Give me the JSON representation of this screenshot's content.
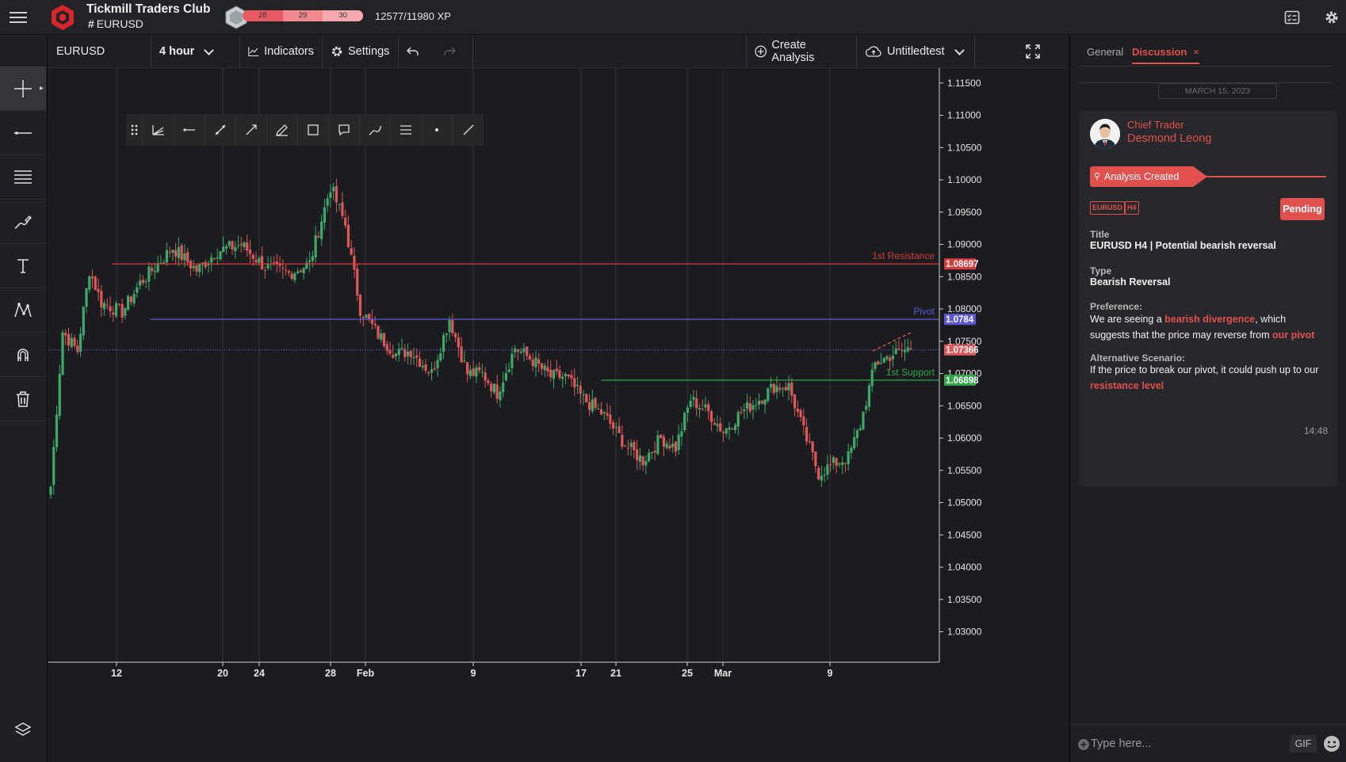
{
  "app": {
    "title": "Tickmill Traders Club",
    "channel_hash": "#",
    "channel": "EURUSD",
    "xp_levels": [
      "28",
      "29",
      "30"
    ],
    "xp_text": "12577/11980 XP"
  },
  "chartbar": {
    "symbol": "EURUSD",
    "interval": "4 hour",
    "indicators": "Indicators",
    "settings": "Settings",
    "create_analysis": "Create Analysis",
    "layout_name": "Untitledtest"
  },
  "chart": {
    "price_ticks": [
      "1.11500",
      "1.11000",
      "1.10500",
      "1.10000",
      "1.09500",
      "1.09000",
      "1.08500",
      "1.08000",
      "1.07500",
      "1.07000",
      "1.06500",
      "1.06000",
      "1.05500",
      "1.05000",
      "1.04500",
      "1.04000",
      "1.03500",
      "1.03000"
    ],
    "date_ticks": [
      {
        "label": "12",
        "bold": true
      },
      {
        "label": "20",
        "bold": true
      },
      {
        "label": "24",
        "bold": true
      },
      {
        "label": "28",
        "bold": true
      },
      {
        "label": "Feb",
        "bold": true
      },
      {
        "label": "9",
        "bold": true
      },
      {
        "label": "17",
        "bold": true
      },
      {
        "label": "21",
        "bold": true
      },
      {
        "label": "25",
        "bold": true
      },
      {
        "label": "Mar",
        "bold": true
      },
      {
        "label": "9",
        "bold": true
      }
    ],
    "levels": [
      {
        "name": "1st Resistance",
        "price": "1.08697",
        "color": "#d93a3a"
      },
      {
        "name": "Pivot",
        "price": "1.0784",
        "color": "#5a5ad8"
      },
      {
        "name": "1st Support",
        "price": "1.06898",
        "color": "#2fa84a"
      }
    ],
    "current_price": "1.07366",
    "colors": {
      "up": "#3fa86a",
      "down": "#e0575a"
    }
  },
  "chart_data": {
    "type": "candlestick",
    "symbol": "EURUSD",
    "interval": "4 hour",
    "x_labels": [
      "12",
      "20",
      "24",
      "28",
      "Feb",
      "9",
      "17",
      "21",
      "25",
      "Mar",
      "9"
    ],
    "ylim": [
      1.026,
      1.117
    ],
    "close_path": [
      [
        0,
        1.0525
      ],
      [
        4,
        1.0765
      ],
      [
        9,
        1.0735
      ],
      [
        13,
        1.086
      ],
      [
        17,
        1.081
      ],
      [
        24,
        1.0795
      ],
      [
        30,
        1.084
      ],
      [
        36,
        1.087
      ],
      [
        41,
        1.0895
      ],
      [
        49,
        1.086
      ],
      [
        56,
        1.089
      ],
      [
        64,
        1.09
      ],
      [
        72,
        1.0865
      ],
      [
        80,
        1.0855
      ],
      [
        87,
        1.087
      ],
      [
        94,
        1.099
      ],
      [
        99,
        1.093
      ],
      [
        104,
        1.08
      ],
      [
        110,
        1.076
      ],
      [
        116,
        1.073
      ],
      [
        121,
        1.0735
      ],
      [
        128,
        1.07
      ],
      [
        134,
        1.0785
      ],
      [
        140,
        1.07
      ],
      [
        145,
        1.07
      ],
      [
        150,
        1.067
      ],
      [
        156,
        1.074
      ],
      [
        162,
        1.072
      ],
      [
        168,
        1.0695
      ],
      [
        173,
        1.0695
      ],
      [
        179,
        1.066
      ],
      [
        186,
        1.0635
      ],
      [
        193,
        1.059
      ],
      [
        199,
        1.0565
      ],
      [
        205,
        1.06
      ],
      [
        210,
        1.0585
      ],
      [
        215,
        1.066
      ],
      [
        221,
        1.064
      ],
      [
        226,
        1.061
      ],
      [
        232,
        1.064
      ],
      [
        238,
        1.066
      ],
      [
        243,
        1.068
      ],
      [
        248,
        1.068
      ],
      [
        253,
        1.061
      ],
      [
        258,
        1.0545
      ],
      [
        263,
        1.056
      ],
      [
        268,
        1.057
      ],
      [
        272,
        1.062
      ],
      [
        277,
        1.0715
      ],
      [
        283,
        1.073
      ],
      [
        289,
        1.074
      ]
    ],
    "levels": [
      {
        "name": "1st Resistance",
        "value": 1.08697
      },
      {
        "name": "Pivot",
        "value": 1.0784
      },
      {
        "name": "1st Support",
        "value": 1.06898
      }
    ],
    "last_price": 1.07366
  },
  "discussion": {
    "tabs": [
      "General",
      "Discussion"
    ],
    "tab_close": "×",
    "date": "MARCH 15, 2023",
    "author_role": "Chief Trader",
    "author_name": "Desmond Leong",
    "status": "Analysis Created",
    "tags": [
      "EURUSD",
      "H4"
    ],
    "pending": "Pending",
    "title_label": "Title",
    "title_value": "EURUSD H4 | Potential bearish reversal",
    "type_label": "Type",
    "type_value": "Bearish Reversal",
    "preference_label": "Preference:",
    "pref_1": "We are seeing a ",
    "pref_2": "bearish divergence",
    "pref_3": ", which suggests that the price may reverse from ",
    "pref_4": "our pivot",
    "alt_label": "Alternative Scenario:",
    "alt_1": "If the price to break our pivot, it could push up to our ",
    "alt_2": "resistance level",
    "time": "14:48",
    "composer_placeholder": "Type here...",
    "gif": "GIF"
  }
}
